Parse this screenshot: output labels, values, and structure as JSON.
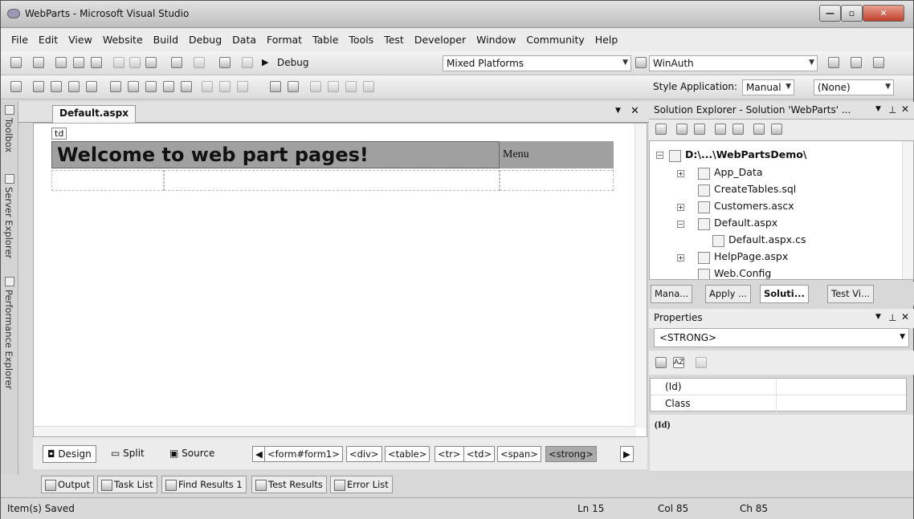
{
  "window": {
    "title": "WebParts - Microsoft Visual Studio"
  },
  "menu": [
    "File",
    "Edit",
    "View",
    "Website",
    "Build",
    "Debug",
    "Data",
    "Format",
    "Table",
    "Tools",
    "Test",
    "Developer",
    "Window",
    "Community",
    "Help"
  ],
  "toolbar1": {
    "config": "Debug",
    "platform": "Mixed Platforms",
    "find_value": "WinAuth"
  },
  "toolbar2": {
    "style_application_label": "Style Application:",
    "style_mode": "Manual",
    "target_rule": "(None)"
  },
  "side_tabs": [
    "Toolbox",
    "Server Explorer",
    "Performance Explorer"
  ],
  "document": {
    "tab_title": "Default.aspx",
    "td_tag": "td",
    "welcome_text": "Welcome to web part pages!",
    "menu_cell_text": "Menu"
  },
  "view_tabs": {
    "design": "Design",
    "split": "Split",
    "source": "Source"
  },
  "tag_path": [
    "<form#form1>",
    "<div>",
    "<table>",
    "<tr>",
    "<td>",
    "<span>",
    "<strong>"
  ],
  "output_tabs": [
    "Output",
    "Task List",
    "Find Results 1",
    "Test Results",
    "Error List"
  ],
  "status": {
    "message": "Item(s) Saved",
    "line": "Ln 15",
    "col": "Col 85",
    "ch": "Ch 85"
  },
  "solution_explorer": {
    "header": "Solution Explorer - Solution 'WebParts' ...",
    "root": "D:\\...\\WebPartsDemo\\",
    "items": [
      "App_Data",
      "CreateTables.sql",
      "Customers.ascx",
      "Default.aspx",
      "Default.aspx.cs",
      "HelpPage.aspx",
      "Web.Config"
    ],
    "bottom_tabs": [
      "Mana...",
      "Apply ...",
      "Soluti...",
      "Test Vi..."
    ]
  },
  "properties": {
    "header": "Properties",
    "selected_object": "<STRONG>",
    "rows": [
      {
        "name": "(Id)",
        "value": ""
      },
      {
        "name": "Class",
        "value": ""
      }
    ],
    "description_title": "(Id)"
  }
}
